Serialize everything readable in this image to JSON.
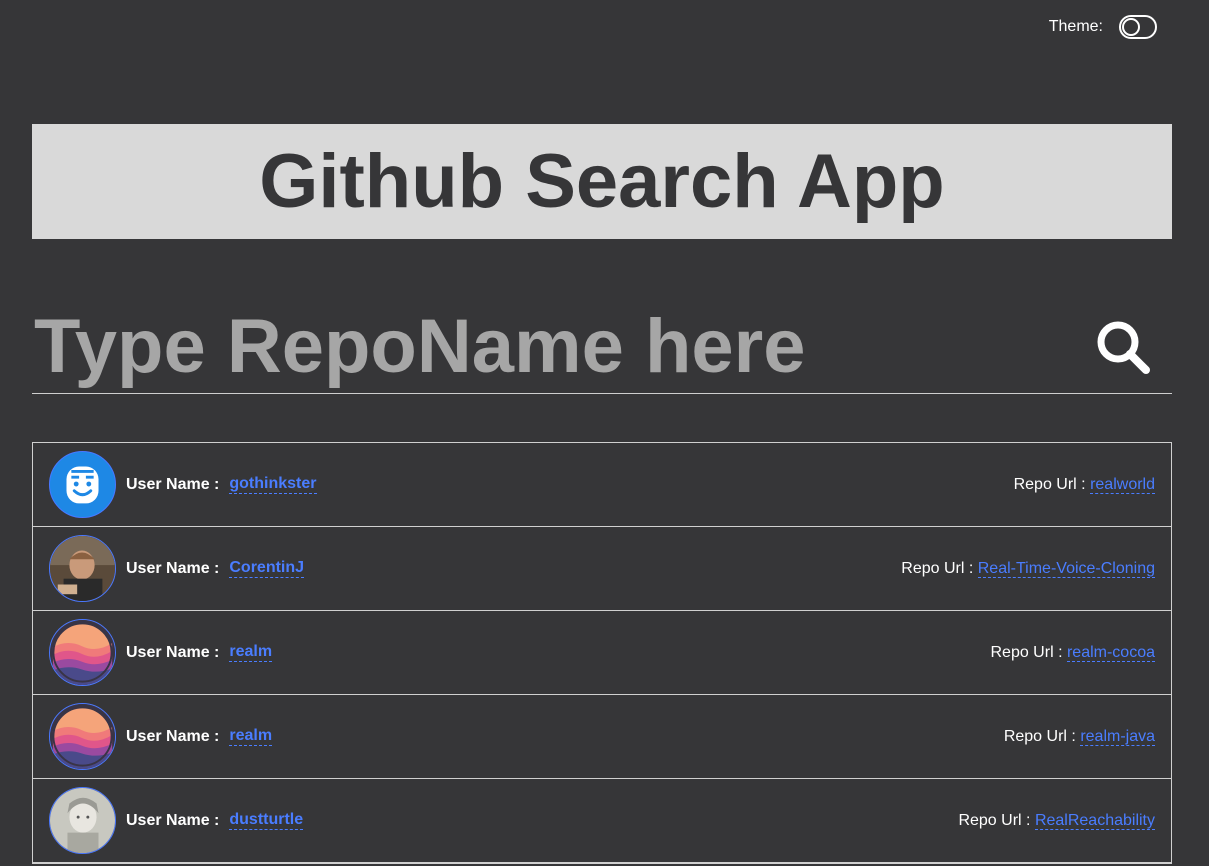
{
  "theme": {
    "label": "Theme:"
  },
  "header": {
    "title": "Github Search App"
  },
  "search": {
    "placeholder": "Type RepoName here",
    "value": ""
  },
  "results": [
    {
      "user_label": "User Name :",
      "user": "gothinkster",
      "repo_label": "Repo Url :",
      "repo": "realworld",
      "avatar": "smiley-face-avatar"
    },
    {
      "user_label": "User Name :",
      "user": "CorentinJ",
      "repo_label": "Repo Url :",
      "repo": "Real-Time-Voice-Cloning",
      "avatar": "photo-avatar"
    },
    {
      "user_label": "User Name :",
      "user": "realm",
      "repo_label": "Repo Url :",
      "repo": "realm-cocoa",
      "avatar": "sunset-waves-avatar"
    },
    {
      "user_label": "User Name :",
      "user": "realm",
      "repo_label": "Repo Url :",
      "repo": "realm-java",
      "avatar": "sunset-waves-avatar"
    },
    {
      "user_label": "User Name :",
      "user": "dustturtle",
      "repo_label": "Repo Url :",
      "repo": "RealReachability",
      "avatar": "sketch-avatar"
    }
  ],
  "colors": {
    "background": "#363638",
    "title_box": "#d9d9d9",
    "link": "#4a7dff"
  },
  "icons": {
    "search": "search-icon",
    "toggle": "theme-toggle"
  }
}
